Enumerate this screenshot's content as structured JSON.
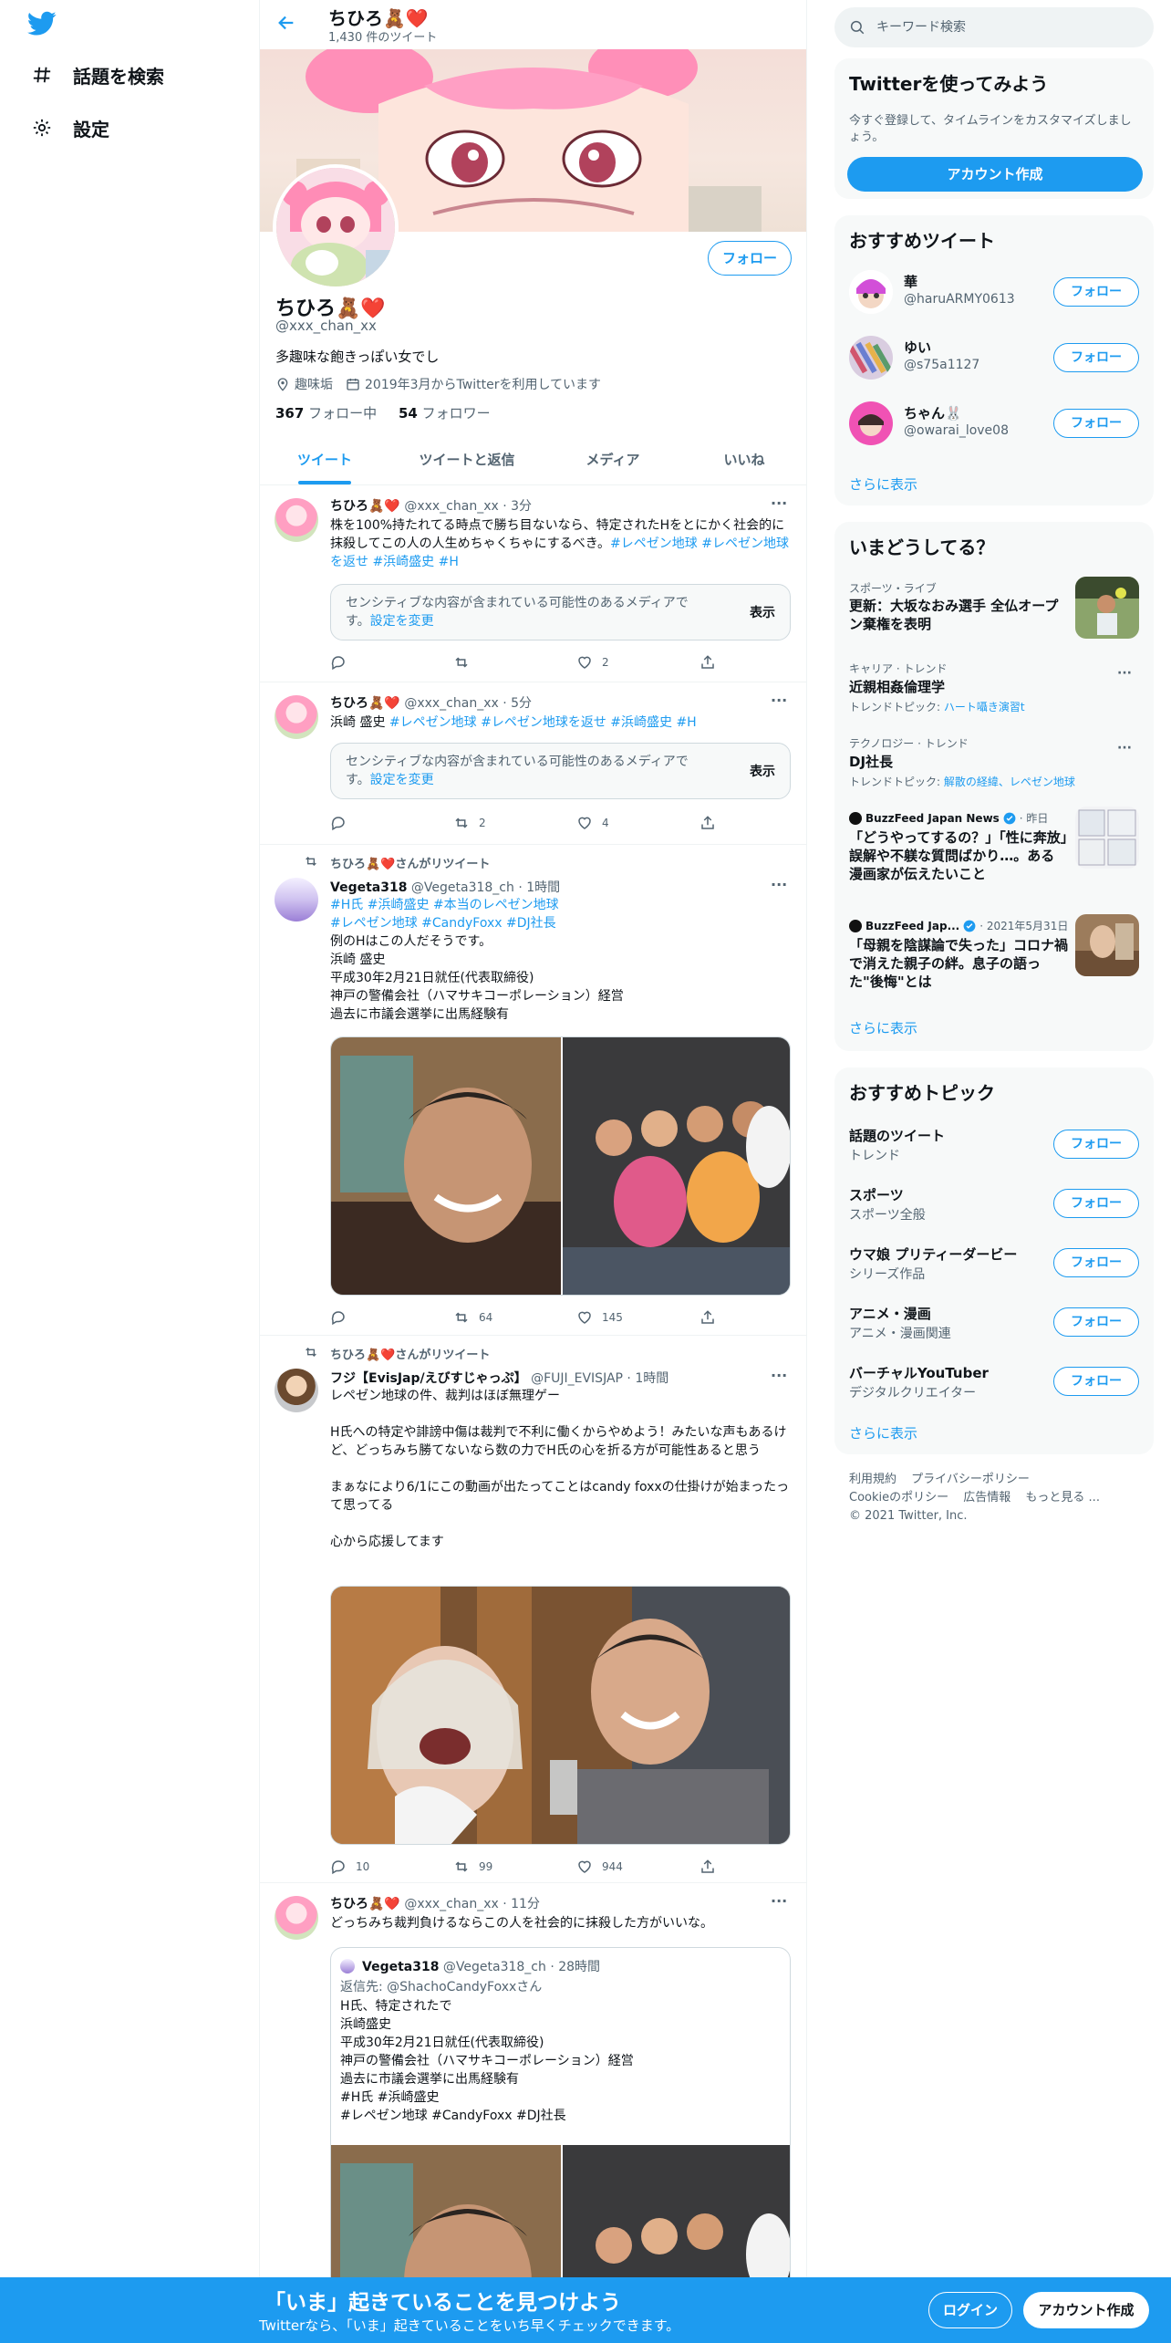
{
  "nav": {
    "explore_label": "話題を検索",
    "settings_label": "設定"
  },
  "header": {
    "name": "ちひろ🧸❤️",
    "tweet_count": "1,430 件のツイート"
  },
  "profile": {
    "follow_label": "フォロー",
    "name": "ちひろ🧸❤️",
    "handle": "@xxx_chan_xx",
    "bio": "多趣味な飽きっぽい女でし",
    "location": "趣味垢",
    "joined": "2019年3月からTwitterを利用しています",
    "following_count": "367",
    "following_label": "フォロー中",
    "followers_count": "54",
    "followers_label": "フォロワー"
  },
  "tabs": [
    "ツイート",
    "ツイートと返信",
    "メディア",
    "いいね"
  ],
  "tweets": [
    {
      "name": "ちひろ🧸❤️",
      "handle_time": " @xxx_chan_xx · 3分",
      "text": "株を100%持たれてる時点で勝ち目ないなら、特定されたHをとにかく社会的に抹殺してこの人の人生めちゃくちゃにするべき。",
      "hashtags": "#レペゼン地球 #レペゼン地球を返せ #浜崎盛史 #H",
      "sensitive_text": "センシティブな内容が含まれている可能性のあるメディアです。",
      "sensitive_link": "設定を変更",
      "sensitive_button": "表示",
      "reply": "",
      "retweet": "",
      "like": "2"
    },
    {
      "name": "ちひろ🧸❤️",
      "handle_time": " @xxx_chan_xx · 5分",
      "text": "浜崎 盛史 ",
      "hashtags": "#レペゼン地球 #レペゼン地球を返せ #浜崎盛史 #H",
      "sensitive_text": "センシティブな内容が含まれている可能性のあるメディアです。",
      "sensitive_link": "設定を変更",
      "sensitive_button": "表示",
      "reply": "",
      "retweet": "2",
      "like": "4"
    },
    {
      "retweet_label": "ちひろ🧸❤️さんがリツイート",
      "name": "Vegeta318",
      "handle_time": " @Vegeta318_ch · 1時間",
      "hashtags": "#H氏 #浜崎盛史 #本当のレペゼン地球\n#レペゼン地球 #CandyFoxx #DJ社長",
      "text": "例のHはこの人だそうです。\n浜崎 盛史\n平成30年2月21日就任(代表取締役)\n神戸の警備会社（ハマサキコーポレーション）経営\n過去に市議会選挙に出馬経験有",
      "reply": "",
      "retweet": "64",
      "like": "145"
    },
    {
      "retweet_label": "ちひろ🧸❤️さんがリツイート",
      "name": "フジ【EvisJap/えびすじゃっぷ】",
      "handle_time": " @FUJI_EVISJAP · 1時間",
      "text": "レペゼン地球の件、裁判はほぼ無理ゲー\n\nH氏への特定や誹謗中傷は裁判で不利に働くからやめよう！みたいな声もあるけど、どっちみち勝てないなら数の力でH氏の心を折る方が可能性あると思う\n\nまぁなにより6/1にこの動画が出たってことはcandy foxxの仕掛けが始まったって思ってる\n\n心から応援してます",
      "reply": "10",
      "retweet": "99",
      "like": "944"
    },
    {
      "name": "ちひろ🧸❤️",
      "handle_time": " @xxx_chan_xx · 11分",
      "text": "どっちみち裁判負けるならこの人を社会的に抹殺した方がいいな。",
      "quote": {
        "name": "Vegeta318",
        "handle_time": " @Vegeta318_ch · 28時間",
        "reply_to": "返信先: @ShachoCandyFoxxさん",
        "text": "H氏、特定されたで\n浜崎盛史\n平成30年2月21日就任(代表取締役)\n神戸の警備会社（ハマサキコーポレーション）経営\n過去に市議会選挙に出馬経験有\n#H氏 #浜崎盛史\n#レペゼン地球 #CandyFoxx #DJ社長"
      }
    }
  ],
  "search": {
    "placeholder": "キーワード検索"
  },
  "signup_card": {
    "title": "Twitterを使ってみよう",
    "subtitle": "今すぐ登録して、タイムラインをカスタマイズしましょう。",
    "button": "アカウント作成"
  },
  "suggested": {
    "title": "おすすめツイート",
    "accounts": [
      {
        "name": "華",
        "handle": "@haruARMY0613"
      },
      {
        "name": "ゆい",
        "handle": "@s75a1127"
      },
      {
        "name": "ちゃん🐰",
        "handle": "@owarai_love08"
      }
    ],
    "follow_label": "フォロー",
    "more": "さらに表示"
  },
  "trends": {
    "title": "いまどうしてる？",
    "items": [
      {
        "category": "スポーツ・ライブ",
        "title": "更新：大坂なおみ選手 全仏オープン棄権を表明"
      },
      {
        "category": "キャリア · トレンド",
        "title": "近親相姦倫理学",
        "sub_prefix": "トレンドトピック: ",
        "sub_link": "ハート囁き演習t"
      },
      {
        "category": "テクノロジー · トレンド",
        "title": "DJ社長",
        "sub_prefix": "トレンドトピック: ",
        "sub_link": "解散の経緯、レペゼン地球"
      }
    ],
    "news": [
      {
        "source": "BuzzFeed Japan News",
        "time": "· 昨日",
        "title": "「どうやってするの？」「性に奔放」誤解や不躾な質問ばかり…。ある漫画家が伝えたいこと"
      },
      {
        "source": "BuzzFeed Jap...",
        "time": "· 2021年5月31日",
        "title": "「母親を陰謀論で失った」コロナ禍で消えた親子の絆。息子の語った\"後悔\"とは"
      }
    ],
    "more": "さらに表示"
  },
  "topics": {
    "title": "おすすめトピック",
    "items": [
      {
        "name": "話題のツイート",
        "sub": "トレンド"
      },
      {
        "name": "スポーツ",
        "sub": "スポーツ全般"
      },
      {
        "name": "ウマ娘 プリティーダービー",
        "sub": "シリーズ作品"
      },
      {
        "name": "アニメ・漫画",
        "sub": "アニメ・漫画関連"
      },
      {
        "name": "バーチャルYouTuber",
        "sub": "デジタルクリエイター"
      }
    ],
    "follow_label": "フォロー",
    "more": "さらに表示"
  },
  "footer": {
    "links": [
      "利用規約",
      "プライバシーポリシー",
      "Cookieのポリシー",
      "広告情報",
      "もっと見る ..."
    ],
    "copyright": "© 2021 Twitter, Inc."
  },
  "bottom": {
    "title": "「いま」起きていることを見つけよう",
    "subtitle": "Twitterなら、「いま」起きていることをいち早くチェックできます。",
    "login": "ログイン",
    "signup": "アカウント作成"
  },
  "colors": {
    "accent": "#1d9bf0",
    "text": "#0f1419",
    "muted": "#536471"
  }
}
